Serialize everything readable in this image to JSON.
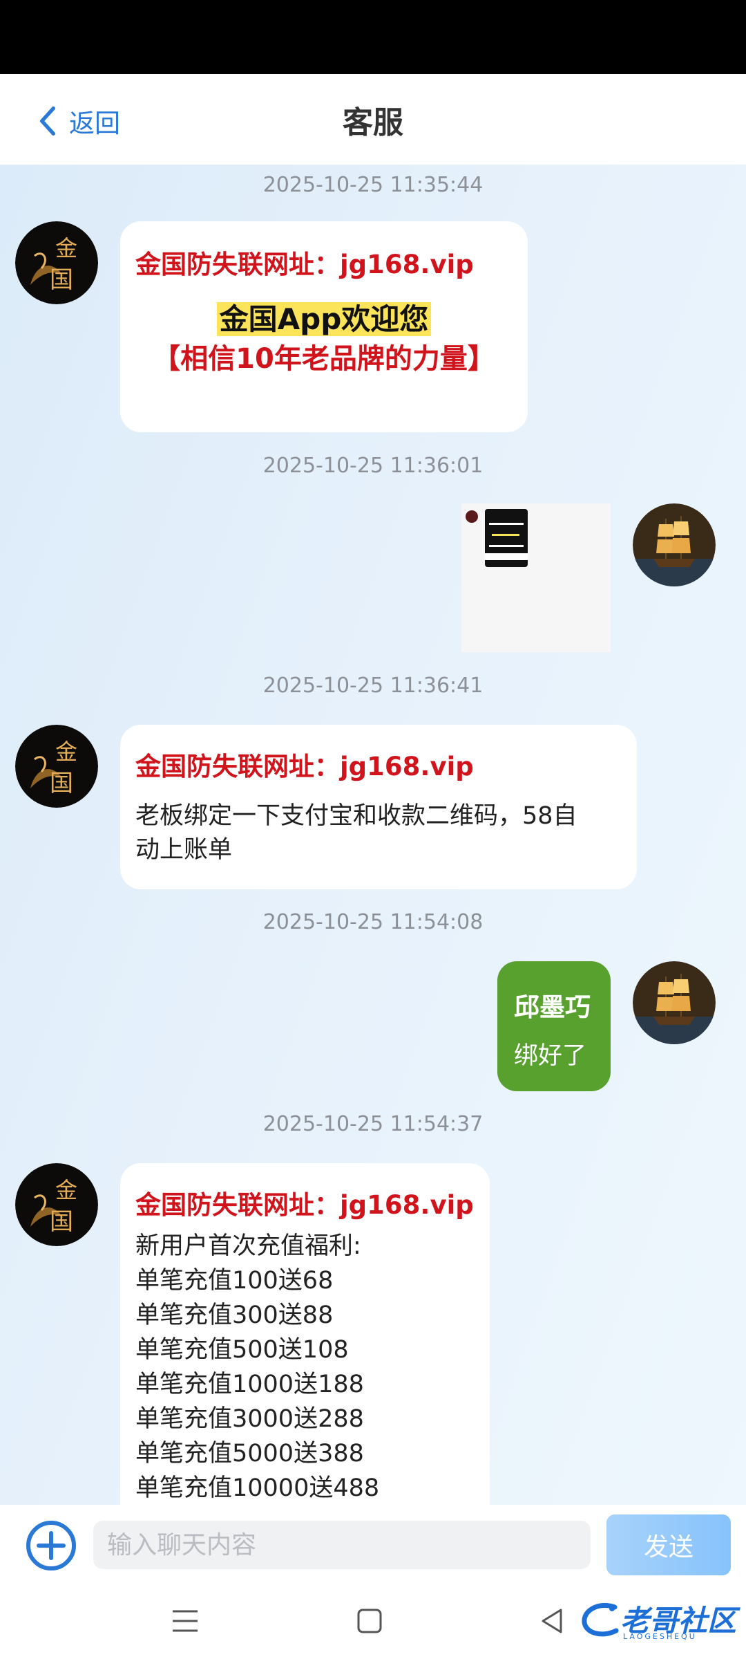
{
  "header": {
    "back_label": "返回",
    "title": "客服"
  },
  "messages": [
    {
      "timestamp": "2025-10-25 11:35:44"
    },
    {
      "timestamp": "2025-10-25 11:36:01"
    },
    {
      "timestamp": "2025-10-25 11:36:41"
    },
    {
      "timestamp": "2025-10-25 11:54:08"
    },
    {
      "timestamp": "2025-10-25 11:54:37"
    }
  ],
  "agent": {
    "url_line": "金国防失联网址：jg168.vip",
    "welcome": "金国App欢迎您",
    "slogan": "【相信10年老品牌的力量】",
    "bind_request_l1": "老板绑定一下支付宝和收款二维码，58自",
    "bind_request_l2": "动上账单",
    "promo_lines": [
      "新用户首次充值福利:",
      "单笔充值100送68",
      "单笔充值300送88",
      "单笔充值500送108",
      "单笔充值1000送188",
      "单笔充值3000送288",
      "单笔充值5000送388",
      "单笔充值10000送488"
    ]
  },
  "user": {
    "name": "邱墨巧",
    "reply": "绑好了"
  },
  "composer": {
    "placeholder": "输入聊天内容",
    "send_label": "发送"
  },
  "watermark": {
    "text": "老哥社区",
    "sub": "LAOGESHEQU"
  },
  "colors": {
    "accent": "#2a79d7",
    "red": "#d1141c",
    "green_bubble": "#58a12f",
    "highlight": "#fce45a"
  }
}
